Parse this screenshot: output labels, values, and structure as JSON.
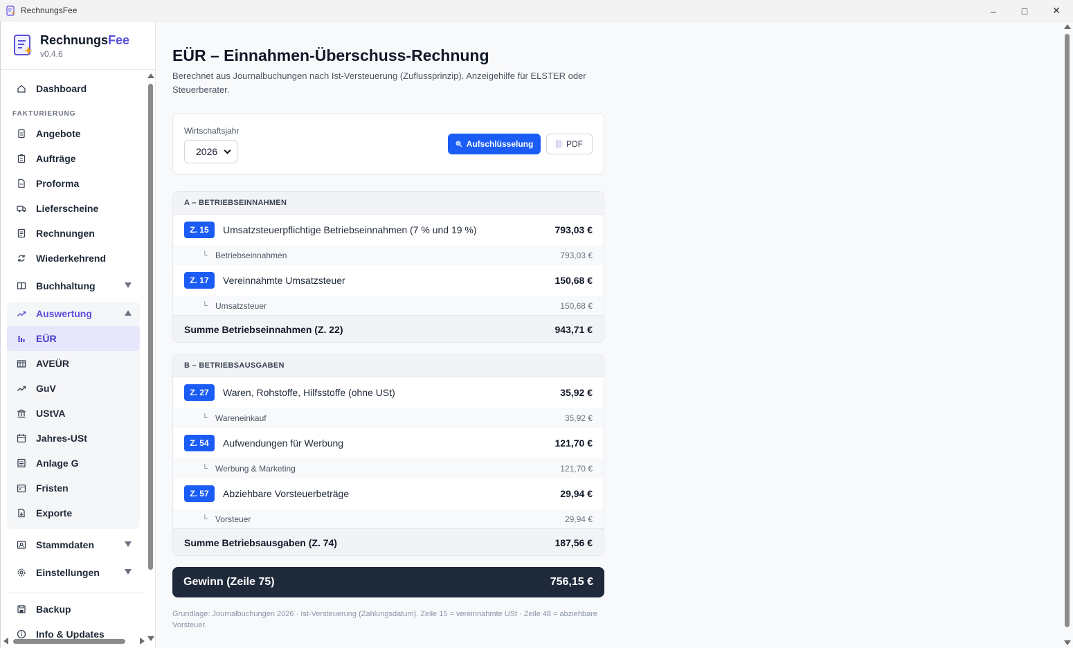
{
  "window": {
    "title": "RechnungsFee",
    "controls": {
      "minimize": "–",
      "maximize": "□",
      "close": "✕"
    }
  },
  "brand": {
    "name_part1": "Rechnungs",
    "name_part2": "Fee",
    "version": "v0.4.6"
  },
  "sidebar": {
    "dashboard": "Dashboard",
    "section_fakturierung": "FAKTURIERUNG",
    "fakturierung_items": [
      "Angebote",
      "Aufträge",
      "Proforma",
      "Lieferscheine",
      "Rechnungen",
      "Wiederkehrend"
    ],
    "buchhaltung": "Buchhaltung",
    "auswertung": "Auswertung",
    "auswertung_items": [
      "EÜR",
      "AVEÜR",
      "GuV",
      "UStVA",
      "Jahres-USt",
      "Anlage G",
      "Fristen",
      "Exporte"
    ],
    "stammdaten": "Stammdaten",
    "einstellungen": "Einstellungen",
    "backup": "Backup",
    "info": "Info & Updates"
  },
  "page": {
    "title": "EÜR – Einnahmen-Überschuss-Rechnung",
    "subtitle": "Berechnet aus Journalbuchungen nach Ist-Versteuerung (Zuflussprinzip). Anzeigehilfe für ELSTER oder Steuerberater."
  },
  "filter": {
    "year_label": "Wirtschaftsjahr",
    "year_value": "2026",
    "breakdown_button": "Aufschlüsselung",
    "pdf_button": "PDF"
  },
  "income": {
    "header": "A – BETRIEBSEINNAHMEN",
    "rows": [
      {
        "badge": "Z. 15",
        "label": "Umsatzsteuerpflichtige Betriebseinnahmen (7 % und 19 %)",
        "amount": "793,03 €",
        "sub_corner": "└",
        "sub_label": "Betriebseinnahmen",
        "sub_amount": "793,03 €"
      },
      {
        "badge": "Z. 17",
        "label": "Vereinnahmte Umsatzsteuer",
        "amount": "150,68 €",
        "sub_corner": "└",
        "sub_label": "Umsatzsteuer",
        "sub_amount": "150,68 €"
      }
    ],
    "sum_label": "Summe Betriebseinnahmen (Z. 22)",
    "sum_amount": "943,71 €"
  },
  "expenses": {
    "header": "B – BETRIEBSAUSGABEN",
    "rows": [
      {
        "badge": "Z. 27",
        "label": "Waren, Rohstoffe, Hilfsstoffe (ohne USt)",
        "amount": "35,92 €",
        "sub_corner": "└",
        "sub_label": "Wareneinkauf",
        "sub_amount": "35,92 €"
      },
      {
        "badge": "Z. 54",
        "label": "Aufwendungen für Werbung",
        "amount": "121,70 €",
        "sub_corner": "└",
        "sub_label": "Werbung & Marketing",
        "sub_amount": "121,70 €"
      },
      {
        "badge": "Z. 57",
        "label": "Abziehbare Vorsteuerbeträge",
        "amount": "29,94 €",
        "sub_corner": "└",
        "sub_label": "Vorsteuer",
        "sub_amount": "29,94 €"
      }
    ],
    "sum_label": "Summe Betriebsausgaben (Z. 74)",
    "sum_amount": "187,56 €"
  },
  "profit": {
    "label": "Gewinn (Zeile 75)",
    "amount": "756,15 €"
  },
  "footnote": "Grundlage: Journalbuchungen 2026 · Ist-Versteuerung (Zahlungsdatum). Zeile 15 = vereinnahmte USt · Zeile 48 = abziehbare Vorsteuer.",
  "colors": {
    "accent": "#1b5cf5",
    "brand": "#5b4fdb",
    "profit_bg": "#1e2939"
  }
}
